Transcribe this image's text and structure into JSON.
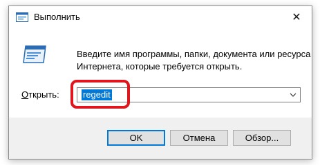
{
  "window": {
    "title": "Выполнить",
    "close_symbol": "✕",
    "icon": "run-icon"
  },
  "body": {
    "description_line1": "Введите имя программы, папки, документа или ресурса",
    "description_line2": "Интернета, которые требуется открыть.",
    "open_label_accel": "О",
    "open_label_rest": "ткрыть:",
    "input_value": "regedit"
  },
  "buttons": {
    "ok": "OK",
    "cancel": "Отмена",
    "browse": "Обзор..."
  },
  "colors": {
    "accent": "#0078d7",
    "highlight": "#e0161e",
    "footer": "#f0f0f0"
  }
}
